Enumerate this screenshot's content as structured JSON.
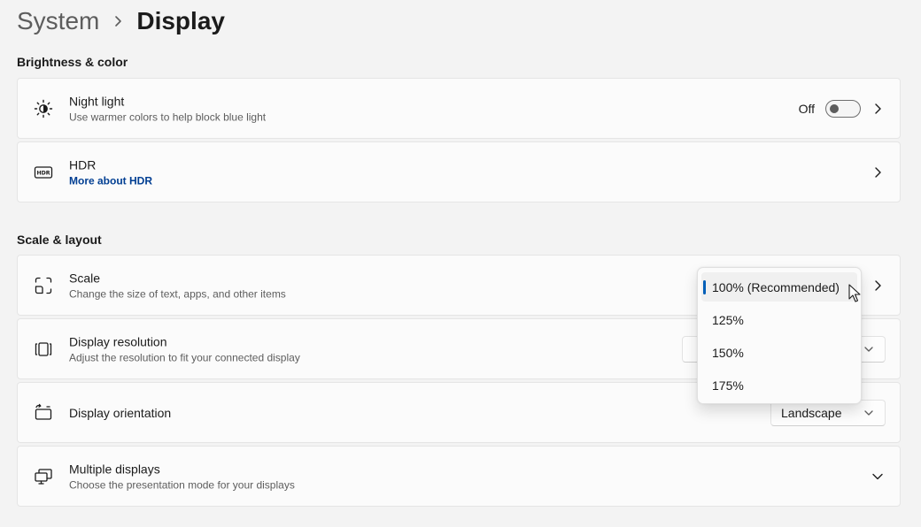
{
  "breadcrumb": {
    "parent": "System",
    "current": "Display"
  },
  "sections": {
    "brightness": "Brightness & color",
    "scale_layout": "Scale & layout"
  },
  "night_light": {
    "title": "Night light",
    "subtitle": "Use warmer colors to help block blue light",
    "toggle_state": "Off"
  },
  "hdr": {
    "title": "HDR",
    "link": "More about HDR"
  },
  "scale": {
    "title": "Scale",
    "subtitle": "Change the size of text, apps, and other items",
    "options": [
      "100% (Recommended)",
      "125%",
      "150%",
      "175%"
    ],
    "selected": "100% (Recommended)"
  },
  "display_resolution": {
    "title": "Display resolution",
    "subtitle": "Adjust the resolution to fit your connected display"
  },
  "display_orientation": {
    "title": "Display orientation",
    "value": "Landscape"
  },
  "multiple_displays": {
    "title": "Multiple displays",
    "subtitle": "Choose the presentation mode for your displays"
  },
  "colors": {
    "accent": "#005fb8",
    "link": "#003e92",
    "background": "#f3f3f3",
    "card": "#fbfbfb"
  },
  "icons": {
    "night_light": "night-light-icon",
    "hdr": "hdr-icon",
    "scale": "scale-icon",
    "resolution": "resolution-icon",
    "orientation": "orientation-icon",
    "multiple_displays": "multiple-displays-icon"
  }
}
